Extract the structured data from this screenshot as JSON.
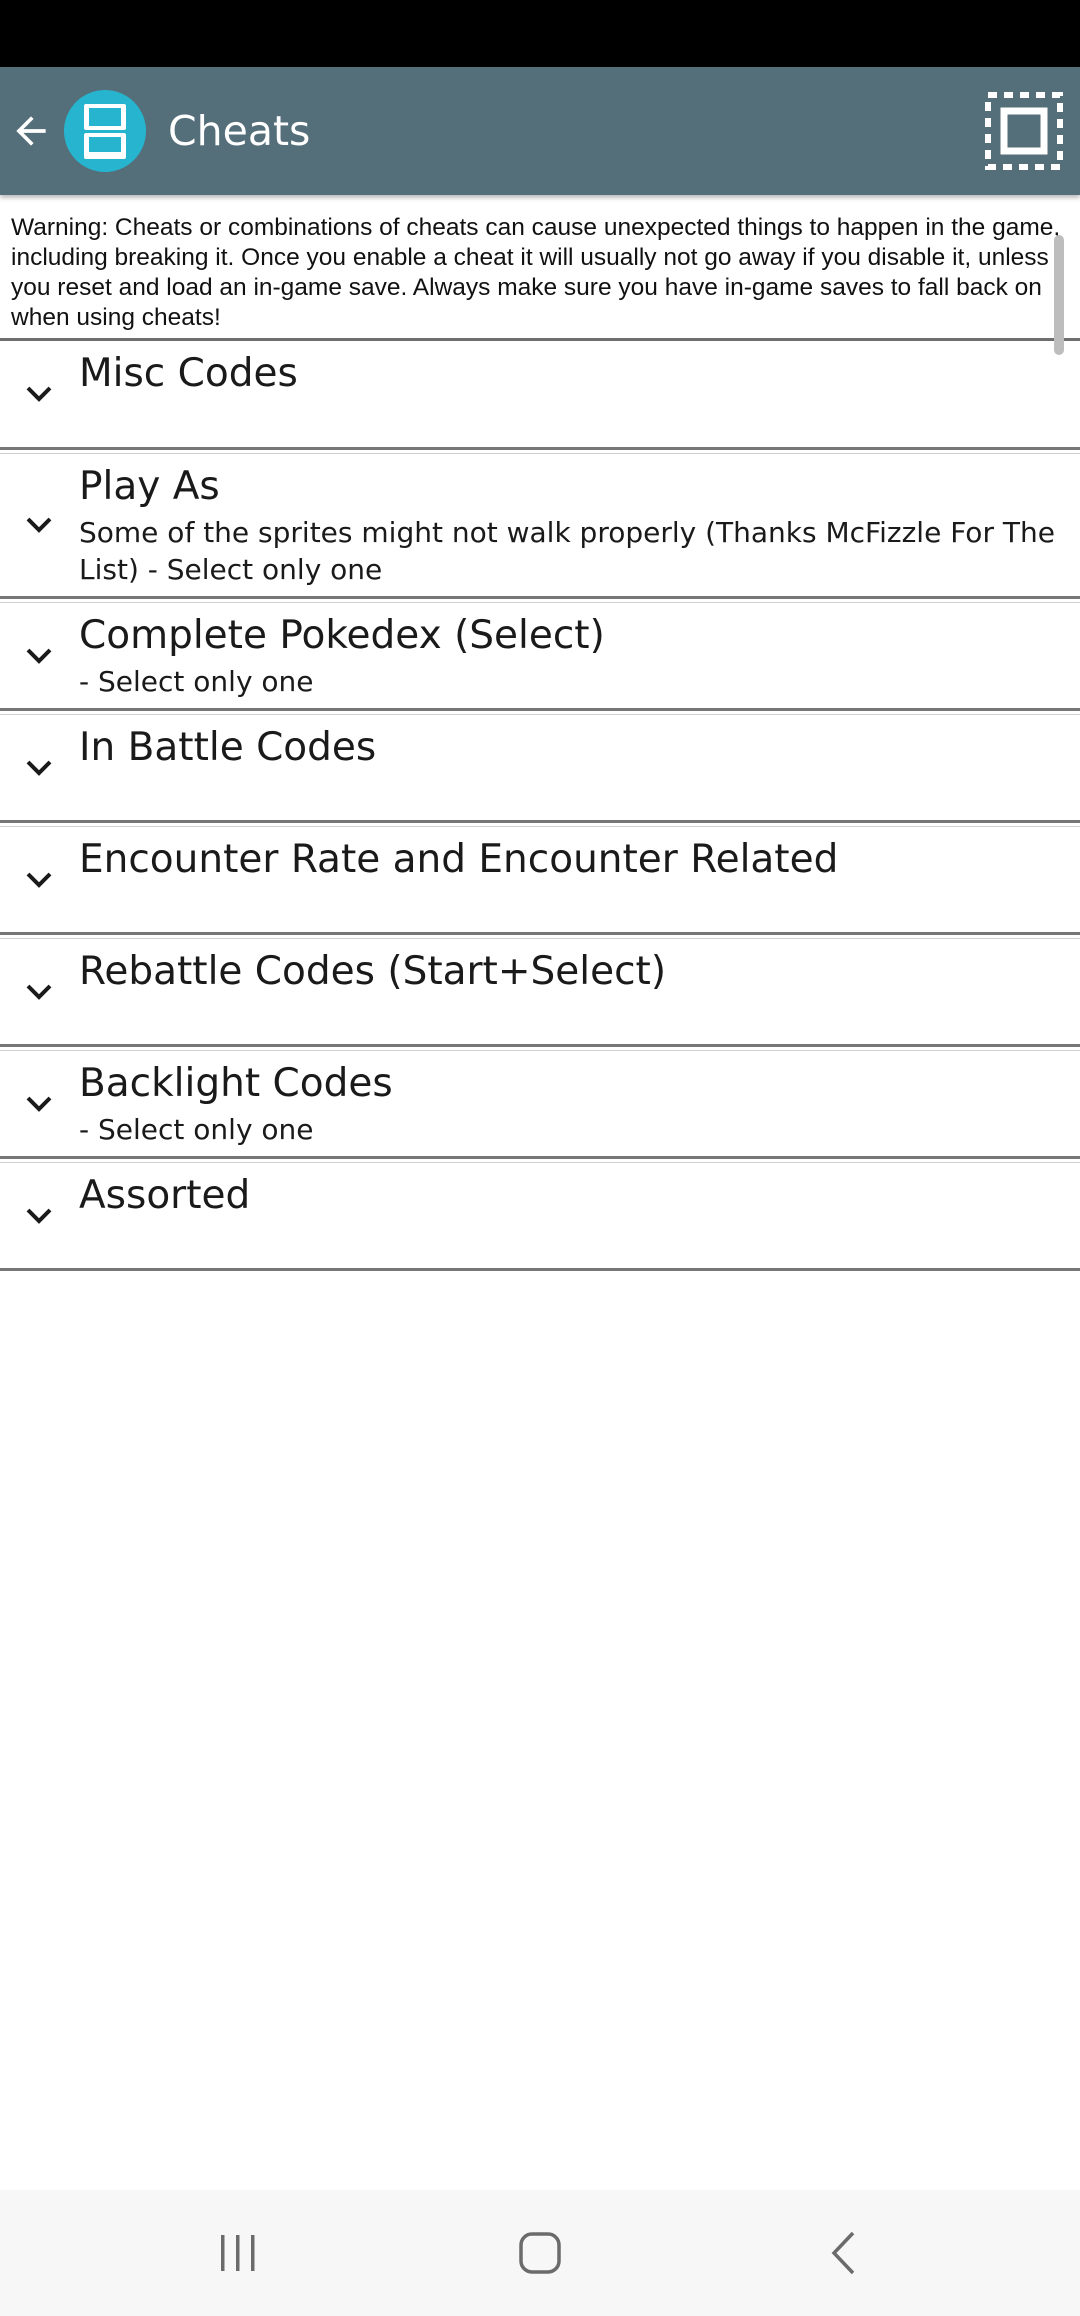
{
  "app_bar": {
    "title": "Cheats",
    "back_icon": "arrow-back-icon",
    "logo_icon": "nintendo-ds-icon",
    "select_all_icon": "select-all-icon",
    "background_color": "#546e7a"
  },
  "warning_text": "Warning: Cheats or combinations of cheats can cause unexpected things to happen in the game, including breaking it. Once you enable a cheat it will usually not go away if you disable it, unless you reset and load an in-game save. Always make sure you have in-game saves to fall back on when using cheats!",
  "categories": [
    {
      "title": "Misc Codes",
      "description": ""
    },
    {
      "title": "Play As",
      "description": "Some of the sprites might not walk properly (Thanks McFizzle For The List) - Select only one"
    },
    {
      "title": "Complete Pokedex (Select)",
      "description": " - Select only one"
    },
    {
      "title": "In Battle Codes",
      "description": ""
    },
    {
      "title": "Encounter Rate and Encounter Related",
      "description": ""
    },
    {
      "title": "Rebattle Codes (Start+Select)",
      "description": ""
    },
    {
      "title": "Backlight Codes",
      "description": " - Select only one"
    },
    {
      "title": "Assorted",
      "description": ""
    }
  ],
  "nav_bar": {
    "recents_icon": "recents-icon",
    "home_icon": "home-icon",
    "back_icon": "back-chevron-icon"
  }
}
